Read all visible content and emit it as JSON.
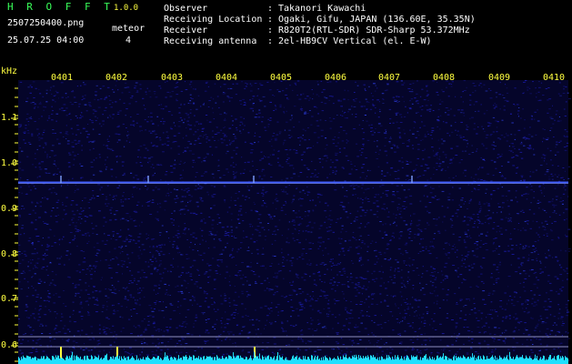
{
  "app": {
    "name": "H R O F F T",
    "version": "1.0.0"
  },
  "file": {
    "name": "2507250400.png",
    "timestamp": "25.07.25 04:00"
  },
  "meteor": {
    "label": "meteor",
    "count": "4"
  },
  "info": [
    {
      "label": "Observer",
      "value": "Takanori Kawachi"
    },
    {
      "label": "Receiving Location",
      "value": "Ogaki, Gifu, JAPAN (136.60E, 35.35N)"
    },
    {
      "label": "Receiver",
      "value": "R820T2(RTL-SDR) SDR-Sharp 53.372MHz"
    },
    {
      "label": "Receiving antenna",
      "value": "2el-HB9CV Vertical (el. E-W)"
    }
  ],
  "axis": {
    "unit": "kHz",
    "time_labels": [
      "0401",
      "0402",
      "0403",
      "0404",
      "0405",
      "0406",
      "0407",
      "0408",
      "0409",
      "0410"
    ],
    "freq_labels": [
      "1.1",
      "1.0",
      "0.9",
      "0.8",
      "0.7",
      "0.6"
    ]
  },
  "colors": {
    "background": "#000000",
    "noise": "#1a1aa0",
    "carrier": "#3f5cff",
    "label_yellow": "#ffff40",
    "title_green": "#39ff5a",
    "signal_cyan": "#20e0ff"
  }
}
